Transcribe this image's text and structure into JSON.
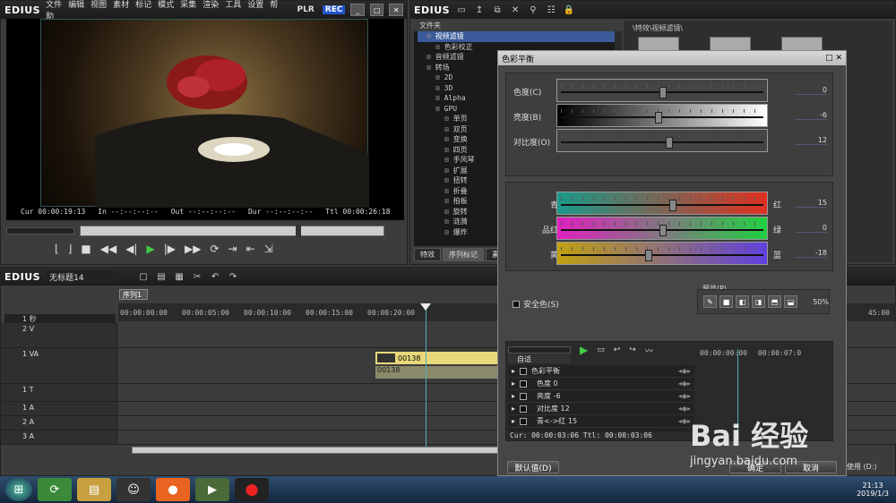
{
  "player": {
    "logo": "EDIUS",
    "menu": [
      "文件",
      "编辑",
      "视图",
      "素材",
      "标记",
      "模式",
      "采集",
      "渲染",
      "工具",
      "设置",
      "帮助"
    ],
    "plr": "PLR",
    "rec": "REC",
    "timecodes": {
      "cur_label": "Cur",
      "cur": "00:00:19:13",
      "in_label": "In",
      "in": "--:--:--:--",
      "out_label": "Out",
      "out": "--:--:--:--",
      "dur_label": "Dur",
      "dur": "--:--:--:--",
      "ttl_label": "Ttl",
      "ttl": "00:00:26:18"
    }
  },
  "bin": {
    "logo": "EDIUS",
    "folder_label": "文件夹",
    "path_label": "\\特效\\视频滤镜\\",
    "tree": [
      {
        "label": "视频滤镜",
        "indent": 1,
        "selected": true
      },
      {
        "label": "色彩校正",
        "indent": 2
      },
      {
        "label": "音频滤镜",
        "indent": 1
      },
      {
        "label": "转场",
        "indent": 1
      },
      {
        "label": "2D",
        "indent": 2
      },
      {
        "label": "3D",
        "indent": 2
      },
      {
        "label": "Alpha",
        "indent": 2
      },
      {
        "label": "GPU",
        "indent": 2
      },
      {
        "label": "单页",
        "indent": 3
      },
      {
        "label": "双页",
        "indent": 3
      },
      {
        "label": "变换",
        "indent": 3
      },
      {
        "label": "四页",
        "indent": 3
      },
      {
        "label": "手风琴",
        "indent": 3
      },
      {
        "label": "扩展",
        "indent": 3
      },
      {
        "label": "扭转",
        "indent": 3
      },
      {
        "label": "折叠",
        "indent": 3
      },
      {
        "label": "拍板",
        "indent": 3
      },
      {
        "label": "旋转",
        "indent": 3
      },
      {
        "label": "涟漪",
        "indent": 3
      },
      {
        "label": "爆炸",
        "indent": 3
      }
    ],
    "tabs": [
      "特效",
      "序列标记",
      "素材"
    ]
  },
  "timeline": {
    "logo": "EDIUS",
    "project": "无标题14",
    "sequence_tab": "序列1",
    "scale": "1 秒",
    "ruler": [
      "00:00:00:00",
      "00:00:05:00",
      "00:00:10:00",
      "00:00:15:00",
      "00:00:20:00"
    ],
    "ruler_right": "45:00",
    "tracks": [
      "2 V",
      "1 VA",
      "1 T",
      "1 A",
      "2 A",
      "3 A"
    ],
    "clip_name": "00138",
    "clip_name2": "00138"
  },
  "dialog": {
    "title": "色彩平衡",
    "sliders_top": [
      {
        "label": "色度(C)",
        "value": "0",
        "pos": 0.5
      },
      {
        "label": "亮度(B)",
        "value": "-6",
        "pos": 0.48
      },
      {
        "label": "对比度(O)",
        "value": "12",
        "pos": 0.53
      }
    ],
    "sliders_color": [
      {
        "left": "青",
        "right": "红",
        "value": "15",
        "pos": 0.55
      },
      {
        "left": "品红",
        "right": "绿",
        "value": "0",
        "pos": 0.5
      },
      {
        "left": "黄",
        "right": "蓝",
        "value": "-18",
        "pos": 0.43
      }
    ],
    "safe_color": "安全色(S)",
    "preview_label": "预览(P)",
    "preview_percent": "50%",
    "auto_label": "自适",
    "kf_items": [
      {
        "label": "色彩平衡",
        "sub": false
      },
      {
        "label": "色度",
        "val": "0",
        "sub": true
      },
      {
        "label": "亮度",
        "val": "-6",
        "sub": true
      },
      {
        "label": "对比度",
        "val": "12",
        "sub": true
      },
      {
        "label": "青<->红",
        "val": "15",
        "sub": true
      }
    ],
    "kf_ruler": [
      "00:00:00:00",
      "00:00:07:0"
    ],
    "cur_ttl": "Cur: 00:00:03:06  Ttl: 00:00:03:06",
    "default_btn": "默认值(D)",
    "ok_btn": "确定",
    "cancel_btn": "取消",
    "right_text": "使用 (D:)"
  },
  "taskbar": {
    "time": "21:13",
    "date": "2019/1/3"
  },
  "watermark": {
    "text": "Bai 经验",
    "url": "jingyan.baidu.com"
  },
  "colors": {
    "accent": "#3a5a9a",
    "clip": "#e8d87a",
    "rec": "#2255cc"
  }
}
